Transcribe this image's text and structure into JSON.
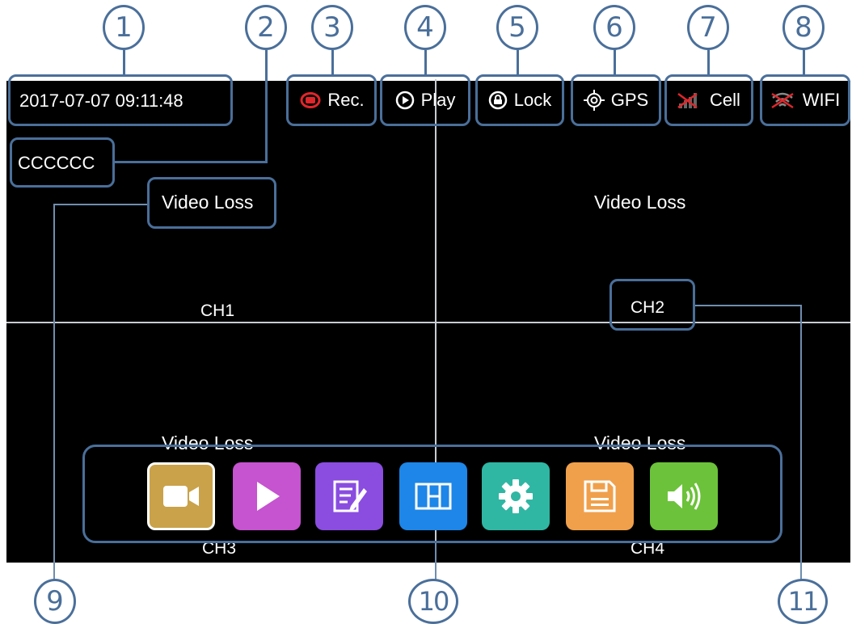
{
  "callouts": [
    "1",
    "2",
    "3",
    "4",
    "5",
    "6",
    "7",
    "8",
    "9",
    "10",
    "11"
  ],
  "status_bar": {
    "datetime": "2017-07-07 09:11:48",
    "device_id": "CCCCCC",
    "rec_label": "Rec.",
    "play_label": "Play",
    "lock_label": "Lock",
    "gps_label": "GPS",
    "cell_label": "Cell",
    "wifi_label": "WIFI"
  },
  "channels": [
    {
      "name": "CH1",
      "status": "Video Loss"
    },
    {
      "name": "CH2",
      "status": "Video Loss"
    },
    {
      "name": "CH3",
      "status": "Video Loss"
    },
    {
      "name": "CH4",
      "status": "Video Loss"
    }
  ],
  "toolbar": {
    "buttons": [
      {
        "icon": "camera-icon",
        "color": "#c9a24a"
      },
      {
        "icon": "play-icon",
        "color": "#c653d0"
      },
      {
        "icon": "edit-icon",
        "color": "#8a4de0"
      },
      {
        "icon": "split-screen-icon",
        "color": "#1d86e8"
      },
      {
        "icon": "gear-icon",
        "color": "#2fb7a4"
      },
      {
        "icon": "save-icon",
        "color": "#f0a04b"
      },
      {
        "icon": "speaker-icon",
        "color": "#6cc23a"
      }
    ]
  },
  "colors": {
    "annotation": "#4a6f9a",
    "rec_red": "#e0262a",
    "screen_bg": "#000000"
  }
}
